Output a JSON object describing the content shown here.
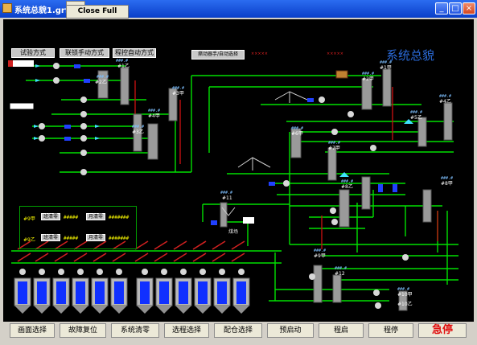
{
  "window": {
    "title": "系统总貌1.grf",
    "minimize": "_",
    "maximize": "□",
    "close": "×"
  },
  "close_full_screen": "Close Full Screen",
  "mode_buttons": {
    "test": "试验方式",
    "manual": "联锁手动方式",
    "auto": "程控自动方式",
    "switch": "撕动器手/自动选择"
  },
  "overview_title": "系统总貌",
  "hash_label": "###.#",
  "units": {
    "u1": "#1甲",
    "u2": "#2甲",
    "u3": "#3甲",
    "u4": "#4甲",
    "u5": "#5甲",
    "u6": "#6甲",
    "u7": "#7甲",
    "u8": "#8甲",
    "u9": "#9甲",
    "u10": "#10甲",
    "u11": "#11",
    "u1b": "#1乙",
    "u2b": "#2乙",
    "u3b": "#3乙",
    "u4b": "#4乙",
    "u5b": "#5乙",
    "u6b": "#6乙",
    "u7b": "#7乙",
    "u8b": "#8乙",
    "u9b": "#9乙",
    "u10b": "#10乙",
    "u12": "#12",
    "u13": "#13"
  },
  "coal_yard": "煤场",
  "red_notes": [
    "×××××",
    "×××××"
  ],
  "panel": {
    "row1_label": "#9甲",
    "row2_label": "#9乙",
    "shift_clear": "班清零",
    "month_clear": "月清零",
    "val_short": "#####",
    "val_long": "#######"
  },
  "bottom_buttons": [
    "画面选择",
    "故障复位",
    "系统清零",
    "选程选择",
    "配仓选择",
    "预启动",
    "程启",
    "程停",
    "急停"
  ],
  "colors": {
    "line": "#00e000",
    "title_blue": "#2a6ad8",
    "estop": "#e01010"
  }
}
